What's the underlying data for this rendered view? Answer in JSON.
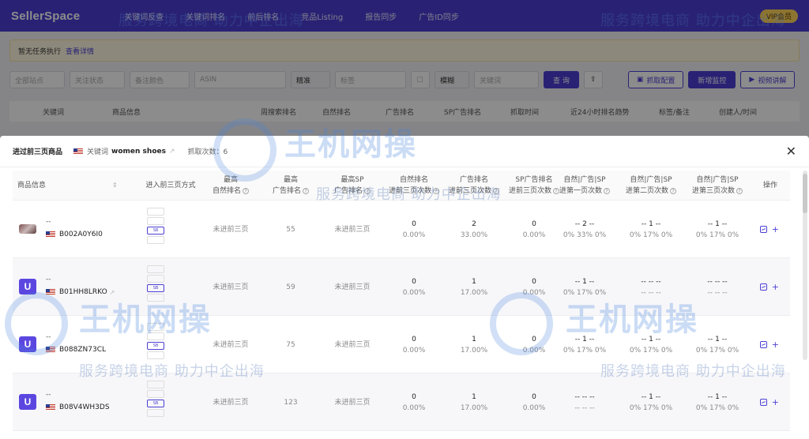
{
  "app": {
    "logo": "SellerSpace",
    "nav": [
      "关键词反查",
      "关键词排名",
      "前后排名",
      "竞品Listing",
      "报告同步",
      "广告ID同步"
    ],
    "vip_badge": "VIP会员"
  },
  "notice": {
    "text": "暂无任务执行",
    "link": "查看详情"
  },
  "filters": {
    "site": "全部站点",
    "follow": "关注状态",
    "remark_color": "备注颜色",
    "asin_placeholder": "ASIN",
    "precise": "精准",
    "tag_placeholder": "标签",
    "fuzzy": "模糊",
    "keyword_placeholder": "关键词",
    "query_btn": "查 询",
    "crawl_config_btn": "抓取配置",
    "add_monitor_btn": "新增监控",
    "video_btn": "视频讲解"
  },
  "bg_table_headers": [
    "关键词",
    "商品信息",
    "周搜索排名",
    "自然排名",
    "广告排名",
    "SP广告排名",
    "抓取时间",
    "近24小时排名趋势",
    "标签/备注",
    "创建人/时间"
  ],
  "modal": {
    "title": "进过前三页商品",
    "keyword_label": "关键词",
    "keyword": "women shoes",
    "crawl_count": "抓取次数：6",
    "columns": [
      {
        "l1": "商品信息",
        "l2": ""
      },
      {
        "l1": "进入前三页方式",
        "l2": ""
      },
      {
        "l1": "最高",
        "l2": "自然排名"
      },
      {
        "l1": "最高",
        "l2": "广告排名"
      },
      {
        "l1": "最高SP",
        "l2": "广告排名"
      },
      {
        "l1": "自然排名",
        "l2": "进前三页次数"
      },
      {
        "l1": "广告排名",
        "l2": "进前三页次数"
      },
      {
        "l1": "SP广告排名",
        "l2": "进前三页次数"
      },
      {
        "l1": "自然|广告|SP",
        "l2": "进第一页次数"
      },
      {
        "l1": "自然|广告|SP",
        "l2": "进第二页次数"
      },
      {
        "l1": "自然|广告|SP",
        "l2": "进第三页次数"
      },
      {
        "l1": "操作",
        "l2": ""
      }
    ],
    "rows": [
      {
        "thumb": "image",
        "name": "--",
        "asin": "B002A0Y6I0",
        "natural": "未进前三页",
        "ad": "55",
        "sp": "未进前三页",
        "c1": {
          "v": "0",
          "p": "0.00%"
        },
        "c2": {
          "v": "2",
          "p": "33.00%"
        },
        "c3": {
          "v": "0",
          "p": "0.00%"
        },
        "p1": {
          "top": "-- 2 --",
          "bot": "0% 33% 0%"
        },
        "p2": {
          "top": "-- 1 --",
          "bot": "0% 17% 0%"
        },
        "p3": {
          "top": "-- 1 --",
          "bot": "0% 17% 0%"
        }
      },
      {
        "thumb": "logo",
        "name": "--",
        "asin": "B01HH8LRKO",
        "natural": "未进前三页",
        "ad": "59",
        "sp": "未进前三页",
        "c1": {
          "v": "0",
          "p": "0.00%"
        },
        "c2": {
          "v": "1",
          "p": "17.00%"
        },
        "c3": {
          "v": "0",
          "p": "0.00%"
        },
        "p1": {
          "top": "-- 1 --",
          "bot": "0% 17% 0%"
        },
        "p2": {
          "top": "-- -- --",
          "bot": "-- -- --"
        },
        "p3": {
          "top": "-- -- --",
          "bot": "-- -- --"
        }
      },
      {
        "thumb": "logo",
        "name": "--",
        "asin": "B088ZN73CL",
        "natural": "未进前三页",
        "ad": "75",
        "sp": "未进前三页",
        "c1": {
          "v": "0",
          "p": "0.00%"
        },
        "c2": {
          "v": "1",
          "p": "17.00%"
        },
        "c3": {
          "v": "0",
          "p": "0.00%"
        },
        "p1": {
          "top": "-- 1 --",
          "bot": "0% 17% 0%"
        },
        "p2": {
          "top": "-- 1 --",
          "bot": "0% 17% 0%"
        },
        "p3": {
          "top": "-- 1 --",
          "bot": "0% 17% 0%"
        }
      },
      {
        "thumb": "logo",
        "name": "--",
        "asin": "B08V4WH3DS",
        "natural": "未进前三页",
        "ad": "123",
        "sp": "未进前三页",
        "c1": {
          "v": "0",
          "p": "0.00%"
        },
        "c2": {
          "v": "1",
          "p": "17.00%"
        },
        "c3": {
          "v": "0",
          "p": "0.00%"
        },
        "p1": {
          "top": "-- -- --",
          "bot": "-- -- --"
        },
        "p2": {
          "top": "-- 1 --",
          "bot": "0% 17% 0%"
        },
        "p3": {
          "top": "-- 1 --",
          "bot": "0% 17% 0%"
        }
      }
    ],
    "entry_tags": [
      "SB"
    ]
  },
  "watermark": {
    "brand": "王机网操",
    "slogan": "服务跨境电商  助力中企出海"
  }
}
